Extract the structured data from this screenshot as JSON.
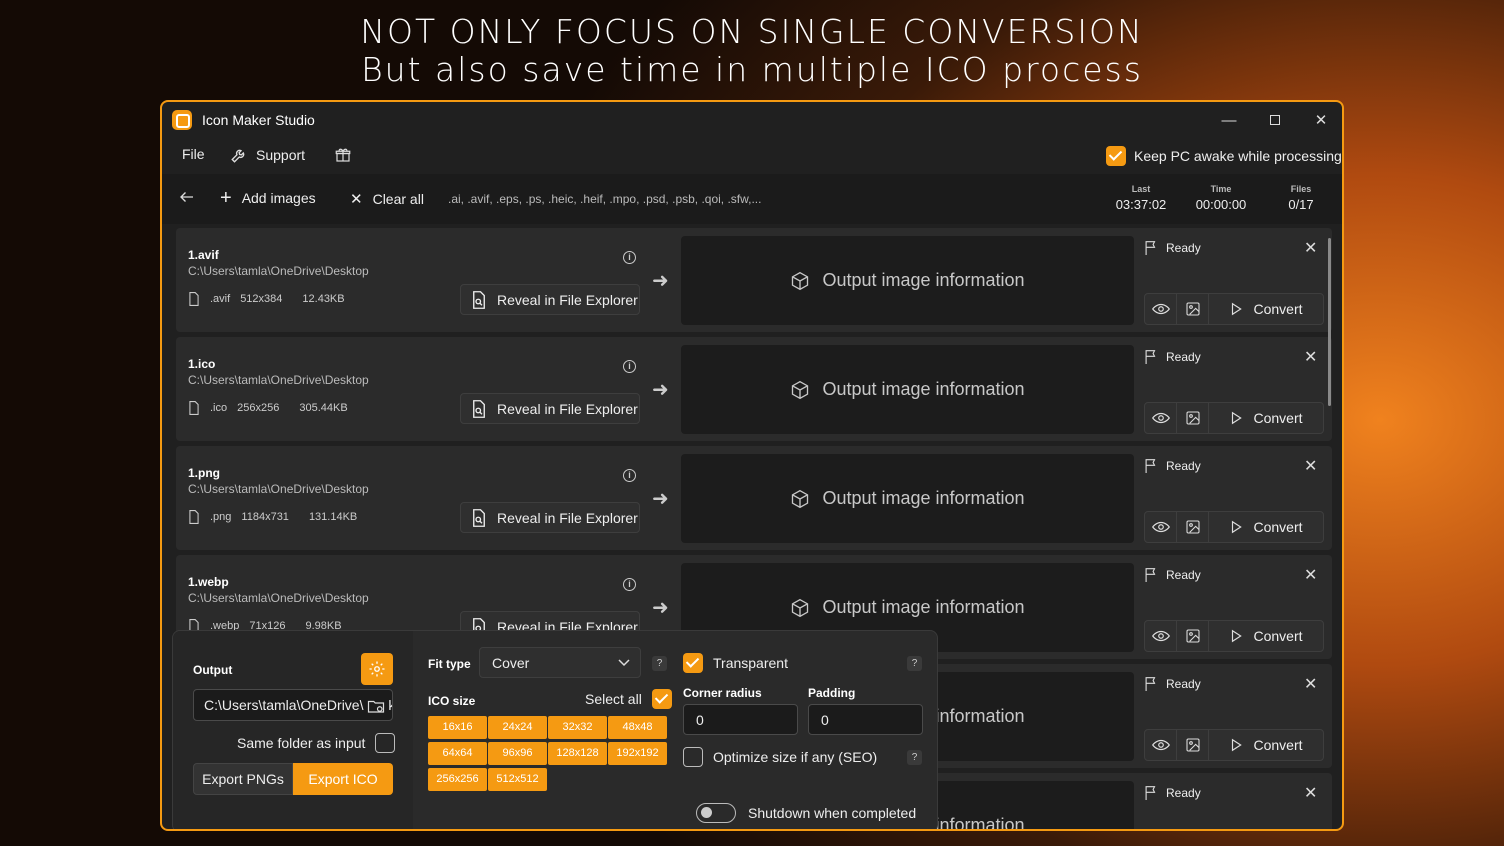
{
  "headline": {
    "line1": "NOT ONLY FOCUS ON SINGLE CONVERSION",
    "line2": "But also save time in multiple ICO process"
  },
  "window": {
    "title": "Icon Maker Studio",
    "accent": "#f59a12"
  },
  "menu": {
    "file": "File",
    "support": "Support",
    "keep_awake": "Keep PC awake while processing"
  },
  "toolbar": {
    "add_images": "Add images",
    "clear_all": "Clear all",
    "formats": ".ai, .avif, .eps, .ps, .heic, .heif, .mpo, .psd, .psb, .qoi, .sfw,...",
    "stats": [
      {
        "label": "Last",
        "value": "03:37:02"
      },
      {
        "label": "Time",
        "value": "00:00:00"
      },
      {
        "label": "Files",
        "value": "0/17"
      }
    ]
  },
  "files": [
    {
      "name": "1.avif",
      "path": "C:\\Users\\tamla\\OneDrive\\Desktop",
      "ext": ".avif",
      "dims": "512x384",
      "size": "12.43KB",
      "reveal": "Reveal in File Explorer",
      "output": "Output image information",
      "status": "Ready",
      "convert": "Convert"
    },
    {
      "name": "1.ico",
      "path": "C:\\Users\\tamla\\OneDrive\\Desktop",
      "ext": ".ico",
      "dims": "256x256",
      "size": "305.44KB",
      "reveal": "Reveal in File Explorer",
      "output": "Output image information",
      "status": "Ready",
      "convert": "Convert"
    },
    {
      "name": "1.png",
      "path": "C:\\Users\\tamla\\OneDrive\\Desktop",
      "ext": ".png",
      "dims": "1184x731",
      "size": "131.14KB",
      "reveal": "Reveal in File Explorer",
      "output": "Output image information",
      "status": "Ready",
      "convert": "Convert"
    },
    {
      "name": "1.webp",
      "path": "C:\\Users\\tamla\\OneDrive\\Desktop",
      "ext": ".webp",
      "dims": "71x126",
      "size": "9.98KB",
      "reveal": "Reveal in File Explorer",
      "output": "Output image information",
      "status": "Ready",
      "convert": "Convert"
    },
    {
      "name": "",
      "path": "",
      "ext": "",
      "dims": "",
      "size": "",
      "reveal": "",
      "output": "Output image information",
      "status": "Ready",
      "convert": "Convert"
    },
    {
      "name": "",
      "path": "",
      "ext": "",
      "dims": "",
      "size": "",
      "reveal": "",
      "output": "Output image information",
      "status": "Ready",
      "convert": ""
    }
  ],
  "panel": {
    "output_label": "Output",
    "output_path": "C:\\Users\\tamla\\OneDrive\\Desktop",
    "same_folder": "Same folder as input",
    "export_pngs": "Export PNGs",
    "export_ico": "Export ICO",
    "fit_type_label": "Fit type",
    "fit_type_value": "Cover",
    "ico_size_label": "ICO size",
    "select_all": "Select all",
    "sizes": [
      "16x16",
      "24x24",
      "32x32",
      "48x48",
      "64x64",
      "96x96",
      "128x128",
      "192x192",
      "256x256",
      "512x512"
    ],
    "transparent": "Transparent",
    "corner_radius_label": "Corner radius",
    "corner_radius_value": "0",
    "padding_label": "Padding",
    "padding_value": "0",
    "optimize": "Optimize size if any (SEO)",
    "shutdown": "Shutdown when completed",
    "help": "?"
  }
}
